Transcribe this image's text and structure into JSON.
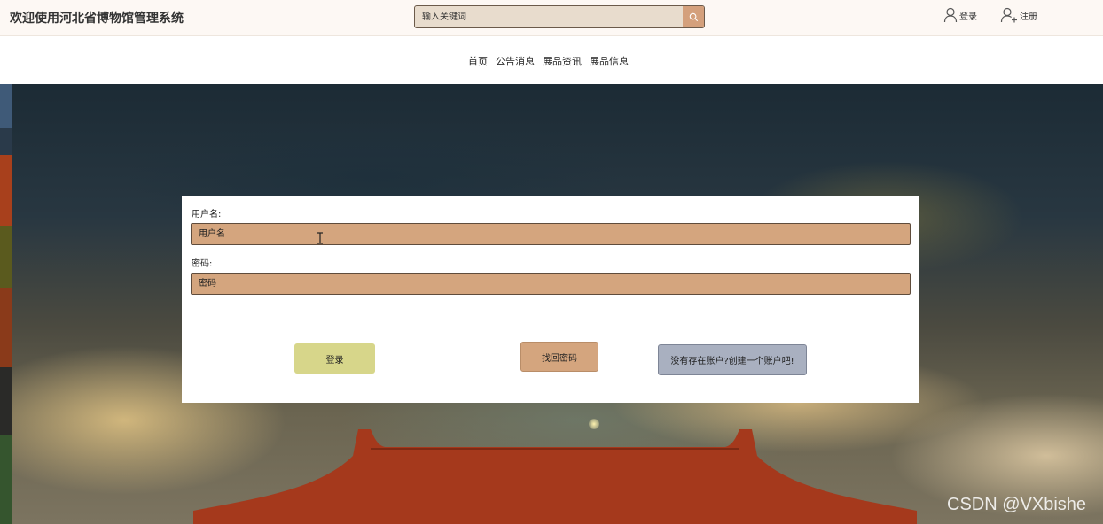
{
  "header": {
    "site_title": "欢迎使用河北省博物馆管理系统",
    "search_placeholder": "输入关键词",
    "search_icon": "search-icon",
    "login_label": "登录",
    "register_label": "注册"
  },
  "nav": {
    "items": [
      {
        "label": "首页"
      },
      {
        "label": "公告消息"
      },
      {
        "label": "展品资讯"
      },
      {
        "label": "展品信息"
      }
    ]
  },
  "login_form": {
    "username_label": "用户名:",
    "username_placeholder": "用户名",
    "password_label": "密码:",
    "password_placeholder": "密码",
    "login_button": "登录",
    "forgot_button": "找回密码",
    "register_button": "没有存在账户?创建一个账户吧!"
  },
  "watermark": "CSDN @VXbishe",
  "colors": {
    "accent": "#d4a57e",
    "login_button": "#d7d68a",
    "register_button": "#a9b0c0",
    "roof": "#a5391c"
  }
}
